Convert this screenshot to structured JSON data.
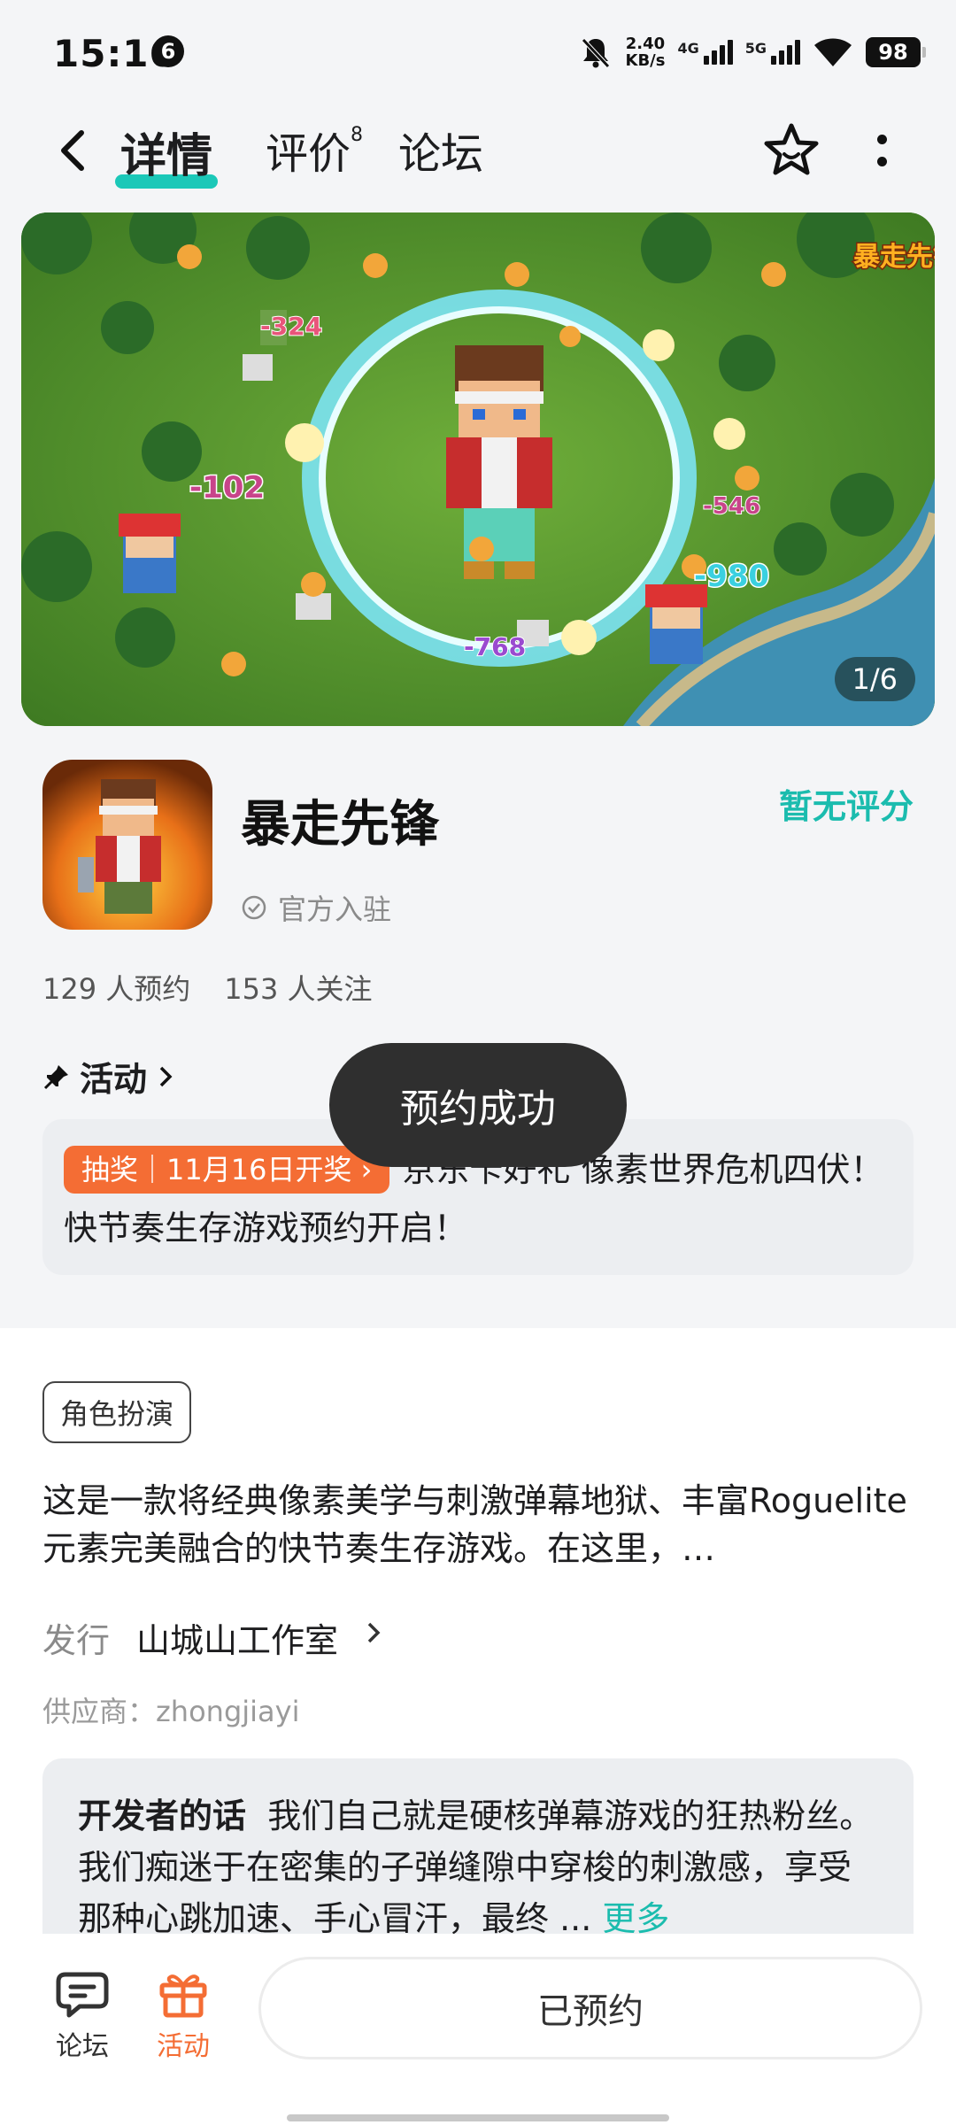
{
  "status_bar": {
    "time": "15:16",
    "notification_count": "6",
    "speed_value": "2.40",
    "speed_unit": "KB/s",
    "net1": "4G",
    "net2": "5G",
    "battery": "98"
  },
  "nav": {
    "tabs": [
      {
        "label": "详情",
        "active": true
      },
      {
        "label": "评价",
        "badge": "8"
      },
      {
        "label": "论坛"
      }
    ],
    "icons": [
      "back-icon",
      "star-icon",
      "more-vertical-icon"
    ]
  },
  "banner": {
    "counter": "1/6",
    "logo_text": "暴走先锋",
    "damage_numbers": [
      "-324",
      "-102",
      "-546",
      "-980",
      "-768"
    ]
  },
  "game": {
    "name": "暴走先锋",
    "official": "官方入驻",
    "rating": "暂无评分",
    "reservations": "129 人预约",
    "followers": "153 人关注"
  },
  "activity": {
    "header": "活动",
    "tag": "抽奖｜11月16日开奖 ›",
    "text": "京东卡好礼 像素世界危机四伏！快节奏生存游戏预约开启！"
  },
  "toast": "预约成功",
  "details": {
    "genre": "角色扮演",
    "description": "这是一款将经典像素美学与刺激弹幕地狱、丰富Roguelite元素完美融合的快节奏生存游戏。在这里，…",
    "publisher_label": "发行",
    "publisher": "山城山工作室",
    "supplier": "供应商：zhongjiayi",
    "dev_label": "开发者的话",
    "dev_text": "我们自己就是硬核弹幕游戏的狂热粉丝。我们痴迷于在密集的子弹缝隙中穿梭的刺激感，享受那种心跳加速、手心冒汗，最终 ...",
    "more": "更多"
  },
  "bottom": {
    "forum": "论坛",
    "activity": "活动",
    "reserved": "已预约"
  },
  "colors": {
    "accent": "#1bc8b8",
    "rating": "#1bbcae",
    "orange": "#f46d34"
  }
}
